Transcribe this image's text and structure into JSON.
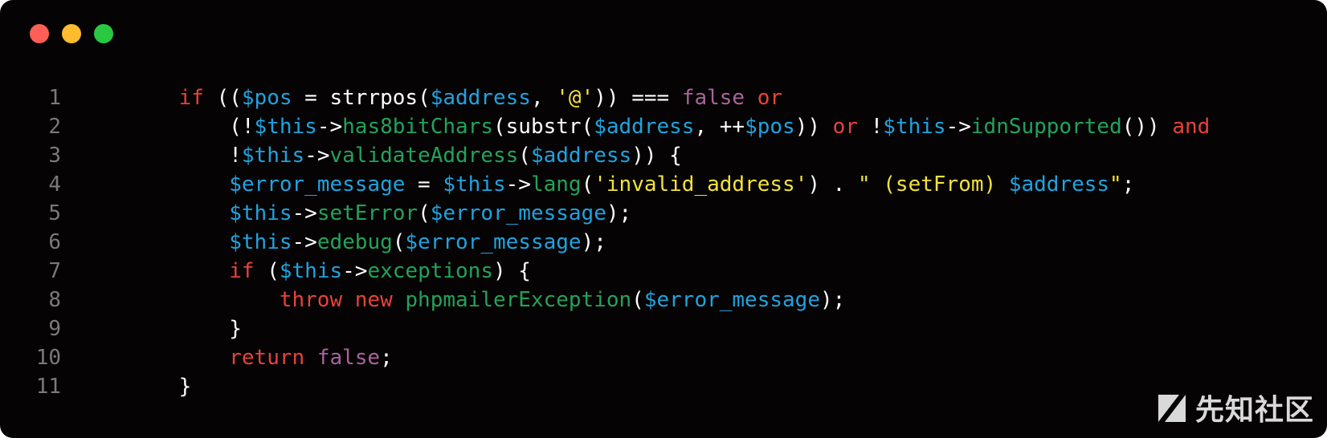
{
  "window": {
    "traffic_lights": [
      {
        "name": "close",
        "color": "#ff5f57"
      },
      {
        "name": "minimize",
        "color": "#febc2e"
      },
      {
        "name": "maximize",
        "color": "#28c840"
      }
    ]
  },
  "theme": {
    "background": "#050303",
    "keyword": "#e8423a",
    "variable": "#1fa3e0",
    "function": "#22a35a",
    "string": "#f3e23a",
    "constant": "#a8649c",
    "plain": "#ffffff",
    "line_number": "#7a7a7a"
  },
  "code_lines": [
    {
      "number": "1",
      "indent": "    ",
      "tokens": [
        {
          "t": "if",
          "c": "keyword"
        },
        {
          "t": " ((",
          "c": "plain"
        },
        {
          "t": "$pos",
          "c": "variable"
        },
        {
          "t": " = strrpos(",
          "c": "plain"
        },
        {
          "t": "$address",
          "c": "variable"
        },
        {
          "t": ", ",
          "c": "plain"
        },
        {
          "t": "'@'",
          "c": "string"
        },
        {
          "t": ")) === ",
          "c": "plain"
        },
        {
          "t": "false",
          "c": "constant"
        },
        {
          "t": " ",
          "c": "plain"
        },
        {
          "t": "or",
          "c": "keyword"
        }
      ]
    },
    {
      "number": "2",
      "indent": "        ",
      "tokens": [
        {
          "t": "(!",
          "c": "plain"
        },
        {
          "t": "$this",
          "c": "variable"
        },
        {
          "t": "->",
          "c": "plain"
        },
        {
          "t": "has8bitChars",
          "c": "function"
        },
        {
          "t": "(substr(",
          "c": "plain"
        },
        {
          "t": "$address",
          "c": "variable"
        },
        {
          "t": ", ++",
          "c": "plain"
        },
        {
          "t": "$pos",
          "c": "variable"
        },
        {
          "t": ")) ",
          "c": "plain"
        },
        {
          "t": "or",
          "c": "keyword"
        },
        {
          "t": " !",
          "c": "plain"
        },
        {
          "t": "$this",
          "c": "variable"
        },
        {
          "t": "->",
          "c": "plain"
        },
        {
          "t": "idnSupported",
          "c": "function"
        },
        {
          "t": "()) ",
          "c": "plain"
        },
        {
          "t": "and",
          "c": "keyword"
        }
      ]
    },
    {
      "number": "3",
      "indent": "        ",
      "tokens": [
        {
          "t": "!",
          "c": "plain"
        },
        {
          "t": "$this",
          "c": "variable"
        },
        {
          "t": "->",
          "c": "plain"
        },
        {
          "t": "validateAddress",
          "c": "function"
        },
        {
          "t": "(",
          "c": "plain"
        },
        {
          "t": "$address",
          "c": "variable"
        },
        {
          "t": ")) {",
          "c": "plain"
        }
      ]
    },
    {
      "number": "4",
      "indent": "        ",
      "tokens": [
        {
          "t": "$error_message",
          "c": "variable"
        },
        {
          "t": " = ",
          "c": "plain"
        },
        {
          "t": "$this",
          "c": "variable"
        },
        {
          "t": "->",
          "c": "plain"
        },
        {
          "t": "lang",
          "c": "function"
        },
        {
          "t": "(",
          "c": "plain"
        },
        {
          "t": "'invalid_address'",
          "c": "string"
        },
        {
          "t": ") . ",
          "c": "plain"
        },
        {
          "t": "\" (setFrom) ",
          "c": "string"
        },
        {
          "t": "$address",
          "c": "variable"
        },
        {
          "t": "\"",
          "c": "string"
        },
        {
          "t": ";",
          "c": "plain"
        }
      ]
    },
    {
      "number": "5",
      "indent": "        ",
      "tokens": [
        {
          "t": "$this",
          "c": "variable"
        },
        {
          "t": "->",
          "c": "plain"
        },
        {
          "t": "setError",
          "c": "function"
        },
        {
          "t": "(",
          "c": "plain"
        },
        {
          "t": "$error_message",
          "c": "variable"
        },
        {
          "t": ");",
          "c": "plain"
        }
      ]
    },
    {
      "number": "6",
      "indent": "        ",
      "tokens": [
        {
          "t": "$this",
          "c": "variable"
        },
        {
          "t": "->",
          "c": "plain"
        },
        {
          "t": "edebug",
          "c": "function"
        },
        {
          "t": "(",
          "c": "plain"
        },
        {
          "t": "$error_message",
          "c": "variable"
        },
        {
          "t": ");",
          "c": "plain"
        }
      ]
    },
    {
      "number": "7",
      "indent": "        ",
      "tokens": [
        {
          "t": "if",
          "c": "keyword"
        },
        {
          "t": " (",
          "c": "plain"
        },
        {
          "t": "$this",
          "c": "variable"
        },
        {
          "t": "->",
          "c": "plain"
        },
        {
          "t": "exceptions",
          "c": "function"
        },
        {
          "t": ") {",
          "c": "plain"
        }
      ]
    },
    {
      "number": "8",
      "indent": "            ",
      "tokens": [
        {
          "t": "throw",
          "c": "keyword"
        },
        {
          "t": " ",
          "c": "plain"
        },
        {
          "t": "new",
          "c": "keyword"
        },
        {
          "t": " ",
          "c": "plain"
        },
        {
          "t": "phpmailerException",
          "c": "function"
        },
        {
          "t": "(",
          "c": "plain"
        },
        {
          "t": "$error_message",
          "c": "variable"
        },
        {
          "t": ");",
          "c": "plain"
        }
      ]
    },
    {
      "number": "9",
      "indent": "        ",
      "tokens": [
        {
          "t": "}",
          "c": "plain"
        }
      ]
    },
    {
      "number": "10",
      "indent": "        ",
      "tokens": [
        {
          "t": "return",
          "c": "keyword"
        },
        {
          "t": " ",
          "c": "plain"
        },
        {
          "t": "false",
          "c": "constant"
        },
        {
          "t": ";",
          "c": "plain"
        }
      ]
    },
    {
      "number": "11",
      "indent": "    ",
      "tokens": [
        {
          "t": "}",
          "c": "plain"
        }
      ]
    }
  ],
  "watermark": {
    "text": "先知社区",
    "icon": "xianzhi-logo-icon"
  }
}
